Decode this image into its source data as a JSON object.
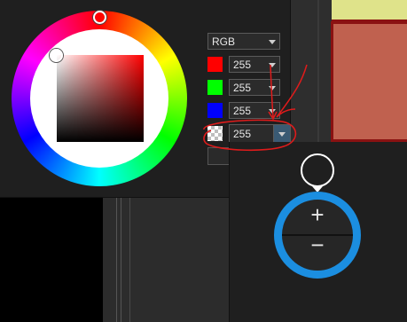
{
  "color_picker": {
    "mode_select": {
      "value": "RGB"
    },
    "channels": [
      {
        "name": "red",
        "value": "255",
        "color": "#ff0000"
      },
      {
        "name": "green",
        "value": "255",
        "color": "#00ff00"
      },
      {
        "name": "blue",
        "value": "255",
        "color": "#0000ff"
      },
      {
        "name": "alpha",
        "value": "255",
        "icon": "checkerboard-icon"
      }
    ]
  },
  "zoom_control": {
    "plus_label": "+",
    "minus_label": "−",
    "accent_color": "#1b8ee0"
  },
  "canvas": {
    "colors": {
      "yellow": "#dfe38a",
      "red": "#c0614f",
      "border": "#8a1212"
    }
  }
}
